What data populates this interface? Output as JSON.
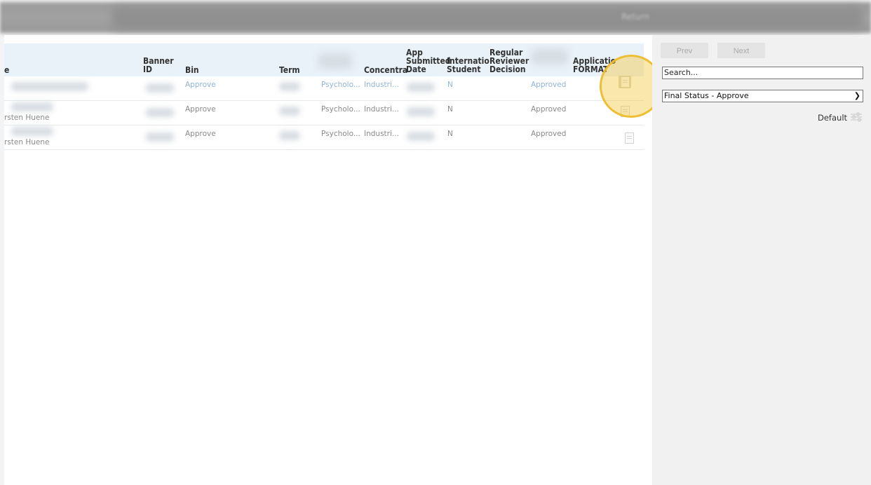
{
  "topbar": {
    "right_label": "Return"
  },
  "table": {
    "headers": {
      "name": "e",
      "banner_id_l1": "Banner",
      "banner_id_l2": "ID",
      "bin": "Bin",
      "term": "Term",
      "concentration": "Concentra",
      "app_submitted_l1": "App",
      "app_submitted_l2": "Submitted",
      "app_submitted_l3": "Date",
      "intl_l1": "Internatio",
      "intl_l2": "Student",
      "regular_l1": "Regular",
      "regular_l2": "Reviewer",
      "regular_l3": "Decision",
      "application_l1": "Applicatio",
      "application_l2": "FORMAT"
    },
    "rows": [
      {
        "name": "",
        "bin": "Approve",
        "program": "Psycholo...",
        "concentration": "Industri...",
        "intl": "N",
        "final_status": "Approved"
      },
      {
        "name": "rsten Huene",
        "bin": "Approve",
        "program": "Psycholo...",
        "concentration": "Industri...",
        "intl": "N",
        "final_status": "Approved"
      },
      {
        "name": "rsten Huene",
        "bin": "Approve",
        "program": "Psycholo...",
        "concentration": "Industri...",
        "intl": "N",
        "final_status": "Approved"
      }
    ]
  },
  "panel": {
    "prev_label": "Prev",
    "next_label": "Next",
    "search_placeholder": "Search...",
    "filter_selected": "Final Status - Approve",
    "default_label": "Default"
  },
  "icons": {
    "document": "document-icon",
    "filter": "filter-sliders-icon",
    "chevron": "chevron-down-icon"
  },
  "colors": {
    "accent_link": "#8fb3da",
    "header_bg": "#e9f1f9",
    "highlight": "#f5ca46"
  }
}
